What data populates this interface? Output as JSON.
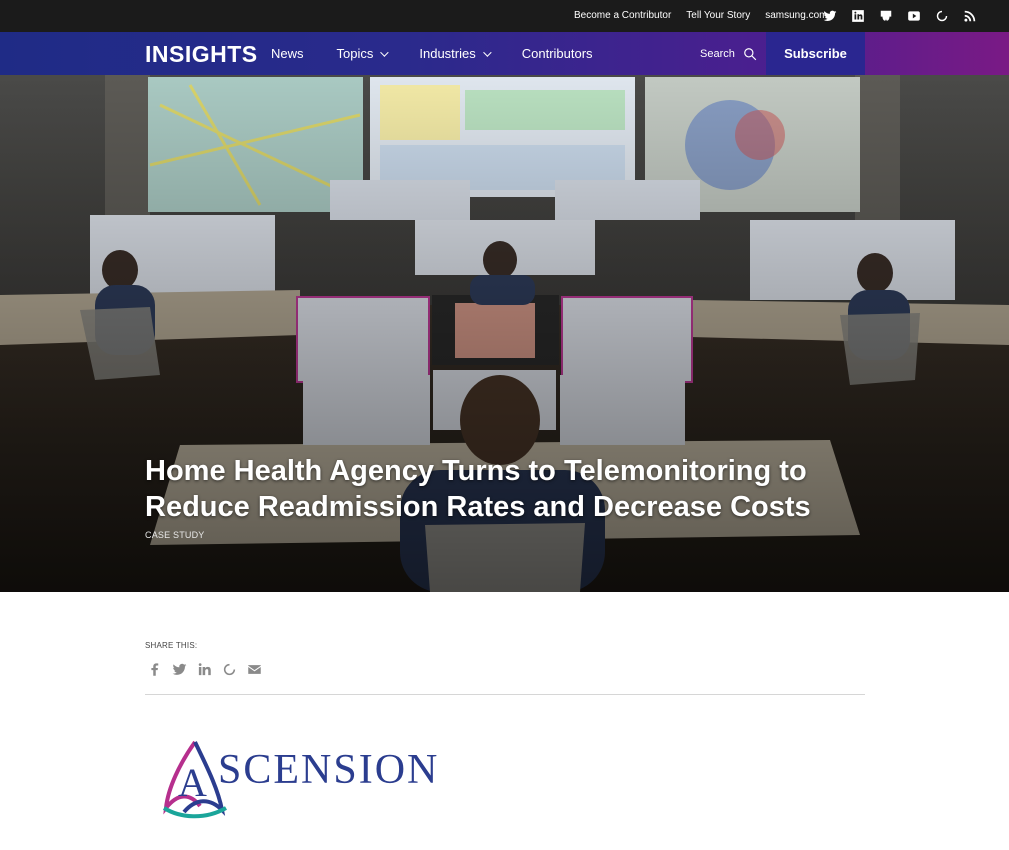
{
  "topbar": {
    "links": [
      "Become a Contributor",
      "Tell Your Story",
      "samsung.com"
    ],
    "social_icons": [
      "twitter-icon",
      "linkedin-icon",
      "slideshare-icon",
      "youtube-icon",
      "loading-icon",
      "rss-icon"
    ]
  },
  "nav": {
    "logo": "INSIGHTS",
    "items": [
      {
        "label": "News",
        "has_dropdown": false
      },
      {
        "label": "Topics",
        "has_dropdown": true
      },
      {
        "label": "Industries",
        "has_dropdown": true
      },
      {
        "label": "Contributors",
        "has_dropdown": false
      }
    ],
    "search_label": "Search",
    "subscribe_label": "Subscribe"
  },
  "hero": {
    "title": "Home Health Agency Turns to Telemonitoring to Reduce Readmission Rates and Decrease Costs",
    "tag": "CASE STUDY"
  },
  "share": {
    "label": "SHARE THIS:",
    "icons": [
      "facebook-icon",
      "twitter-icon",
      "linkedin-icon",
      "loading-icon",
      "email-icon"
    ]
  },
  "logo_image": {
    "wordmark": "SCENSION",
    "initial": "A"
  },
  "colors": {
    "topbar_bg": "#1b1b1b",
    "nav_gradient_start": "#1f2b86",
    "nav_gradient_end": "#7a1a85",
    "subscribe_bg": "#2a2690",
    "ascension_blue": "#2b3d8f"
  }
}
